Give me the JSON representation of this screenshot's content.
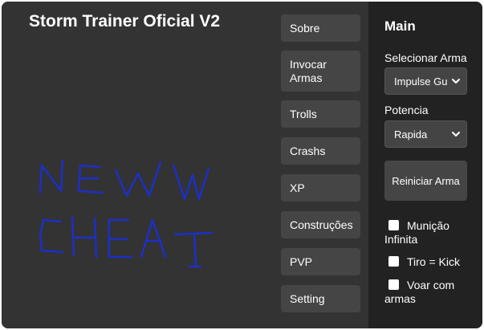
{
  "app": {
    "title": "Storm Trainer Oficial V2"
  },
  "menu": {
    "items": [
      {
        "label": "Sobre",
        "name": "sobre"
      },
      {
        "label": "Invocar Armas",
        "name": "invocar-armas"
      },
      {
        "label": "Trolls",
        "name": "trolls"
      },
      {
        "label": "Crashs",
        "name": "crashs"
      },
      {
        "label": "XP",
        "name": "xp"
      },
      {
        "label": "Construções",
        "name": "construcoes"
      },
      {
        "label": "PVP",
        "name": "pvp"
      },
      {
        "label": "Setting",
        "name": "setting"
      }
    ]
  },
  "drawing": {
    "text": "NEW CHEAT",
    "color": "#1c2fc8"
  },
  "panel": {
    "heading": "Main",
    "weapon_label": "Selecionar Arma",
    "weapon_value": "Impulse Gun",
    "power_label": "Potencia",
    "power_value": "Rapida",
    "reset_label": "Reiniciar Arma",
    "checks": [
      {
        "label": "Munição Infinita",
        "checked": false
      },
      {
        "label": "Tiro = Kick",
        "checked": false
      },
      {
        "label": "Voar com armas",
        "checked": false
      }
    ]
  },
  "icons": {
    "select_arrow": "chevron-down-icon",
    "checkbox": "checkbox-icon"
  },
  "colors": {
    "window_bg": "#333333",
    "side_panel_bg": "#222222",
    "button_bg": "#454545",
    "text": "#ffffff"
  }
}
